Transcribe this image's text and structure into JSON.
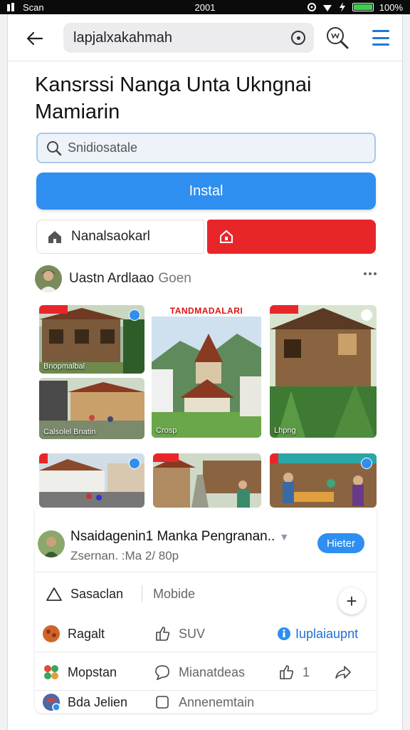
{
  "status_bar": {
    "left_text": "Scan",
    "time": "2001",
    "battery": "100%",
    "battery_level": 1.0
  },
  "toolbar": {
    "url": "lapjalxakahmah"
  },
  "page": {
    "title": "Kansrssi Nanga Unta Ukngnai Mamiarin"
  },
  "search": {
    "placeholder": "Snidiosatale"
  },
  "install": {
    "label": "Instal"
  },
  "segment": {
    "left_label": "Nanalsaokarl"
  },
  "author": {
    "name": "Uastn Ardlaao",
    "sub": "Goen"
  },
  "gallery": {
    "banner": "TANDMADALARI",
    "captions": [
      "Bnopmalbal",
      "Calsolel Bnatin",
      "Crosp",
      "Lhpng"
    ]
  },
  "post": {
    "title": "Nsaidagenin1 Manka Pengranan..",
    "meta": "Zsernan.  :Ma 2/ 80p",
    "filter_label": "Hieter"
  },
  "actions": {
    "row1": {
      "left": "Sasaclan",
      "right": "Mobide"
    },
    "row2": {
      "left": "Ragalt",
      "mid": "SUV",
      "right": "Iuplaiaupnt"
    },
    "row3": {
      "left": "Mopstan",
      "mid": "Mianatdeas",
      "count": "1"
    },
    "row4": {
      "left": "Bda Jelien",
      "mid": "Annenemtain"
    }
  },
  "colors": {
    "accent": "#2e8ff0",
    "danger": "#e8262a",
    "link": "#1e6fd9"
  },
  "icons": [
    "back-arrow-icon",
    "target-icon",
    "search-icon",
    "menu-icon",
    "home-icon",
    "house-icon",
    "warning-triangle-icon",
    "like-icon",
    "comment-icon",
    "thumbs-up-icon",
    "share-icon",
    "checkbox-icon",
    "plus-icon"
  ]
}
